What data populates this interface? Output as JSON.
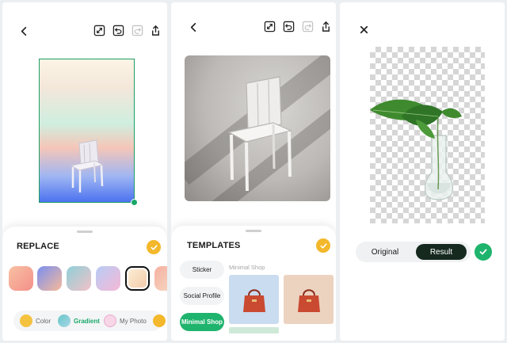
{
  "replace_screen": {
    "toolbar": {
      "back": "back-icon",
      "actions": [
        "expand-icon",
        "undo-icon",
        "redo-icon",
        "share-icon"
      ]
    },
    "sheet": {
      "title": "REPLACE",
      "swatches": [
        {
          "colors": [
            "#f8c1a2",
            "#f48f89"
          ],
          "selected": false
        },
        {
          "colors": [
            "#7a8ff0",
            "#f7b99a"
          ],
          "selected": false
        },
        {
          "colors": [
            "#8fd0d8",
            "#f2c1c8"
          ],
          "selected": false
        },
        {
          "colors": [
            "#b7ccf5",
            "#f6b8d6"
          ],
          "selected": false
        },
        {
          "colors": [
            "#fcf0d6",
            "#f3c8a8"
          ],
          "selected": true
        },
        {
          "colors": [
            "#f7b0a0",
            "#f5dcc8"
          ],
          "selected": false
        }
      ],
      "modes": [
        {
          "label": "Color",
          "icon": "yellow-dot",
          "active": false
        },
        {
          "label": "Gradient",
          "icon": "gradient-dot",
          "active": true
        },
        {
          "label": "My Photo",
          "icon": "photo-dot",
          "active": false
        }
      ]
    }
  },
  "templates_screen": {
    "toolbar": {
      "back": "back-icon",
      "actions": [
        "expand-icon",
        "undo-icon",
        "redo-icon",
        "share-icon"
      ]
    },
    "sheet": {
      "title": "TEMPLATES",
      "categories": [
        {
          "label": "Sticker",
          "active": false
        },
        {
          "label": "Social Profile",
          "active": false
        },
        {
          "label": "Minimal Shop",
          "active": true
        }
      ],
      "group_label": "Minimal Shop",
      "templates": [
        {
          "bg": "#c9dcf0",
          "item": "handbag"
        },
        {
          "bg": "#ecd3c0",
          "item": "handbag"
        }
      ]
    }
  },
  "result_screen": {
    "close": "close-icon",
    "toggle": {
      "original": "Original",
      "result": "Result",
      "active": "Result"
    },
    "confirm": "check-icon"
  },
  "colors": {
    "accent_green": "#1fb46d",
    "accent_yellow": "#f3b82b",
    "dark_toggle": "#15291f"
  }
}
